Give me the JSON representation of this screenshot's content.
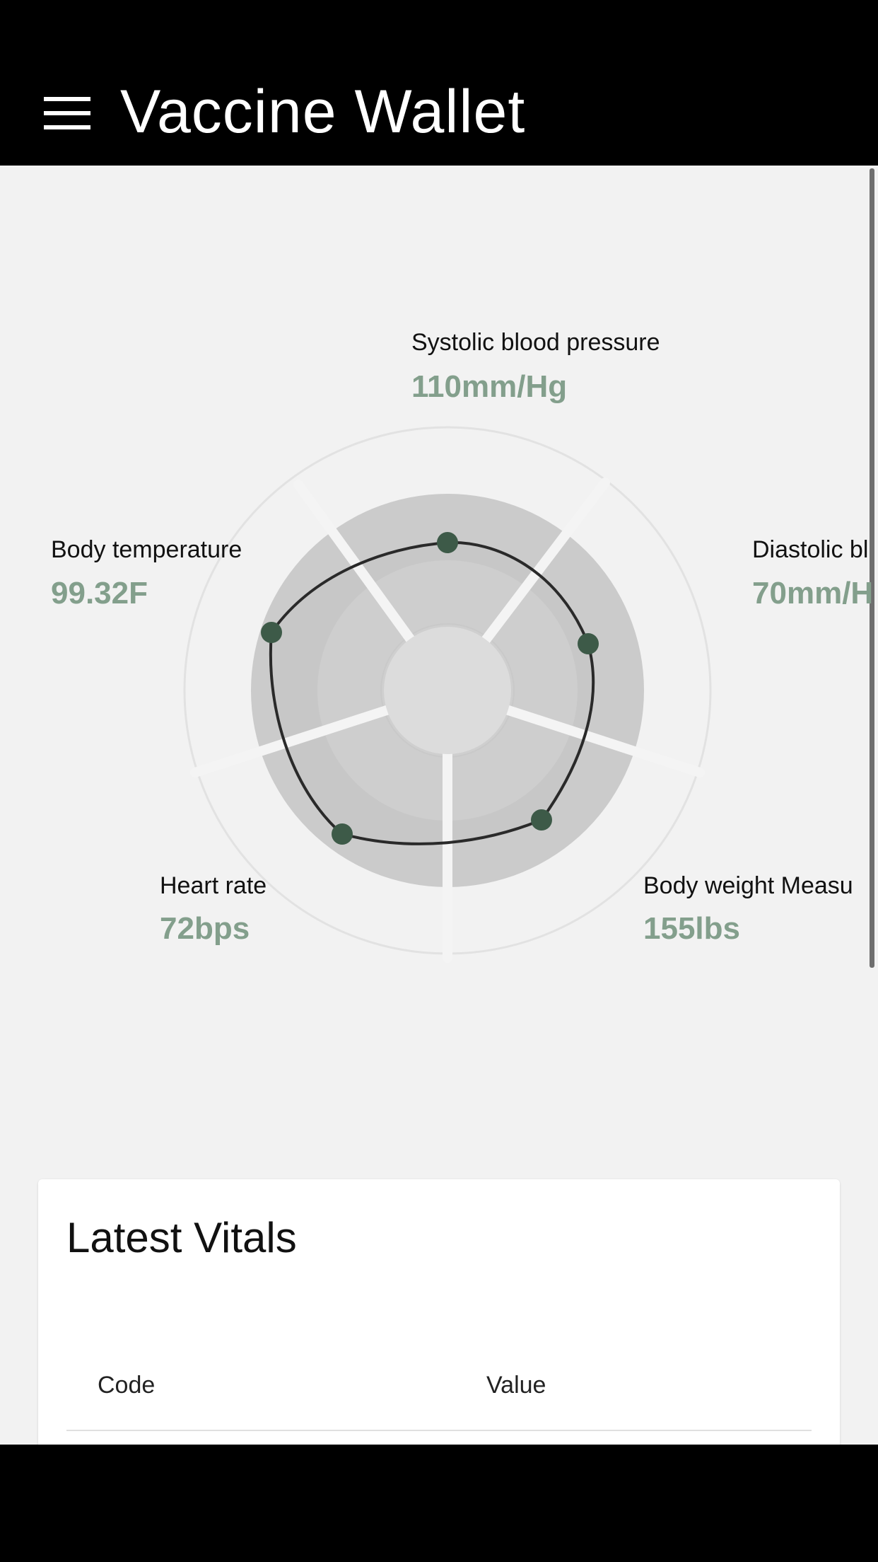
{
  "app_bar": {
    "title": "Vaccine Wallet",
    "menu_icon": "hamburger-menu-icon"
  },
  "vitals_chart": {
    "axes": [
      {
        "label": "Systolic blood pressure",
        "value": "110mm/Hg"
      },
      {
        "label": "Diastolic bl",
        "value": "70mm/H"
      },
      {
        "label": "Body weight Measu",
        "value": "155lbs"
      },
      {
        "label": "Heart rate",
        "value": "72bps"
      },
      {
        "label": "Body temperature",
        "value": "99.32F"
      }
    ],
    "colors": {
      "value_text": "#839f8c",
      "data_point": "#3d5a48",
      "outline": "#2a2a2a",
      "ring_dark": "#cbcbcb",
      "ring_mid": "#d8d8d8",
      "ring_light": "#f2f2f2"
    }
  },
  "latest_vitals": {
    "title": "Latest Vitals",
    "columns": [
      "Code",
      "Value"
    ]
  }
}
